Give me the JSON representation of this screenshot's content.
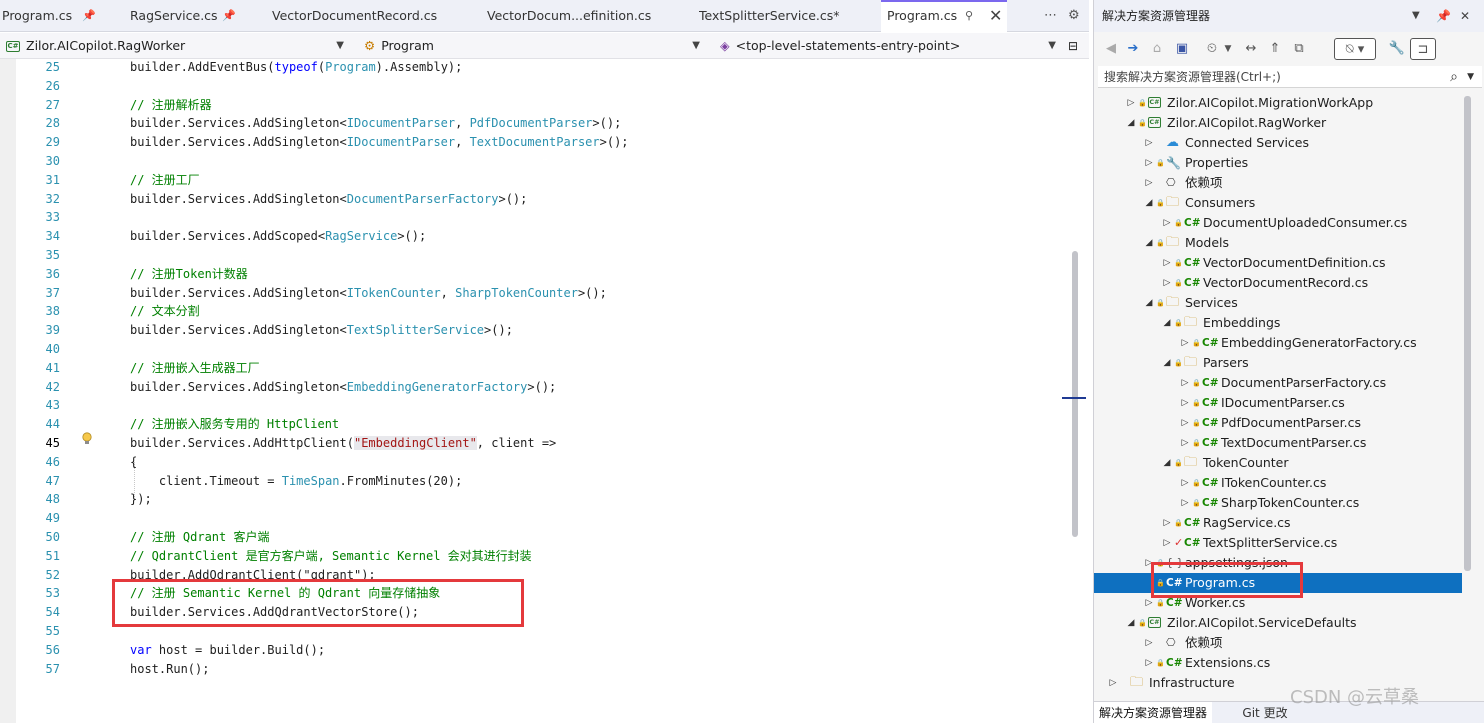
{
  "tabs": [
    {
      "label": "Program.cs",
      "pinned": true
    },
    {
      "label": "RagService.cs",
      "pinned": true
    },
    {
      "label": "VectorDocumentRecord.cs"
    },
    {
      "label": "VectorDocum...efinition.cs"
    },
    {
      "label": "TextSplitterService.cs*"
    },
    {
      "label": "Program.cs",
      "active": true
    }
  ],
  "navbar": {
    "project": "Zilor.AICopilot.RagWorker",
    "type": "Program",
    "member": "<top-level-statements-entry-point>"
  },
  "editor": {
    "current_line": "45",
    "lines": [
      {
        "n": "25",
        "segs": [
          {
            "t": "builder.AddEventBus("
          },
          {
            "t": "typeof",
            "c": "kw"
          },
          {
            "t": "("
          },
          {
            "t": "Program",
            "c": "ty"
          },
          {
            "t": ").Assembly);"
          }
        ]
      },
      {
        "n": "26",
        "segs": []
      },
      {
        "n": "27",
        "segs": [
          {
            "t": "// 注册解析器",
            "c": "cm"
          }
        ]
      },
      {
        "n": "28",
        "segs": [
          {
            "t": "builder.Services.AddSingleton<"
          },
          {
            "t": "IDocumentParser",
            "c": "ty"
          },
          {
            "t": ", "
          },
          {
            "t": "PdfDocumentParser",
            "c": "ty"
          },
          {
            "t": ">();"
          }
        ]
      },
      {
        "n": "29",
        "segs": [
          {
            "t": "builder.Services.AddSingleton<"
          },
          {
            "t": "IDocumentParser",
            "c": "ty"
          },
          {
            "t": ", "
          },
          {
            "t": "TextDocumentParser",
            "c": "ty"
          },
          {
            "t": ">();"
          }
        ]
      },
      {
        "n": "30",
        "segs": []
      },
      {
        "n": "31",
        "segs": [
          {
            "t": "// 注册工厂",
            "c": "cm"
          }
        ]
      },
      {
        "n": "32",
        "segs": [
          {
            "t": "builder.Services.AddSingleton<"
          },
          {
            "t": "DocumentParserFactory",
            "c": "ty"
          },
          {
            "t": ">();"
          }
        ]
      },
      {
        "n": "33",
        "segs": []
      },
      {
        "n": "34",
        "segs": [
          {
            "t": "builder.Services.AddScoped<"
          },
          {
            "t": "RagService",
            "c": "ty"
          },
          {
            "t": ">();"
          }
        ]
      },
      {
        "n": "35",
        "segs": []
      },
      {
        "n": "36",
        "segs": [
          {
            "t": "// 注册Token计数器",
            "c": "cm"
          }
        ]
      },
      {
        "n": "37",
        "segs": [
          {
            "t": "builder.Services.AddSingleton<"
          },
          {
            "t": "ITokenCounter",
            "c": "ty"
          },
          {
            "t": ", "
          },
          {
            "t": "SharpTokenCounter",
            "c": "ty"
          },
          {
            "t": ">();"
          }
        ]
      },
      {
        "n": "38",
        "segs": [
          {
            "t": "// 文本分割",
            "c": "cm"
          }
        ]
      },
      {
        "n": "39",
        "segs": [
          {
            "t": "builder.Services.AddSingleton<"
          },
          {
            "t": "TextSplitterService",
            "c": "ty"
          },
          {
            "t": ">();"
          }
        ]
      },
      {
        "n": "40",
        "segs": []
      },
      {
        "n": "41",
        "segs": [
          {
            "t": "// 注册嵌入生成器工厂",
            "c": "cm"
          }
        ]
      },
      {
        "n": "42",
        "segs": [
          {
            "t": "builder.Services.AddSingleton<"
          },
          {
            "t": "EmbeddingGeneratorFactory",
            "c": "ty"
          },
          {
            "t": ">();"
          }
        ]
      },
      {
        "n": "43",
        "segs": []
      },
      {
        "n": "44",
        "segs": [
          {
            "t": "// 注册嵌入服务专用的 HttpClient",
            "c": "cm"
          }
        ]
      },
      {
        "n": "45",
        "segs": [
          {
            "t": "builder.Services.AddHttpClient("
          },
          {
            "t": "\"EmbeddingClient\"",
            "c": "st hl"
          },
          {
            "t": ", client =>"
          }
        ]
      },
      {
        "n": "46",
        "segs": [
          {
            "t": "{"
          }
        ]
      },
      {
        "n": "47",
        "segs": [
          {
            "t": "    client.Timeout = "
          },
          {
            "t": "TimeSpan",
            "c": "ty"
          },
          {
            "t": ".FromMinutes(20);"
          }
        ]
      },
      {
        "n": "48",
        "segs": [
          {
            "t": "});"
          }
        ]
      },
      {
        "n": "49",
        "segs": []
      },
      {
        "n": "50",
        "segs": [
          {
            "t": "// 注册 Qdrant 客户端",
            "c": "cm"
          }
        ]
      },
      {
        "n": "51",
        "segs": [
          {
            "t": "// QdrantClient 是官方客户端, Semantic Kernel 会对其进行封装",
            "c": "cm"
          }
        ]
      },
      {
        "n": "52",
        "segs": [
          {
            "t": "builder.AddQdrantClient(\"qdrant\");"
          }
        ]
      },
      {
        "n": "53",
        "segs": [
          {
            "t": "// 注册 Semantic Kernel 的 Qdrant 向量存储抽象",
            "c": "cm"
          }
        ]
      },
      {
        "n": "54",
        "segs": [
          {
            "t": "builder.Services.AddQdrantVectorStore();"
          }
        ]
      },
      {
        "n": "55",
        "segs": []
      },
      {
        "n": "56",
        "segs": [
          {
            "t": "var",
            "c": "kw"
          },
          {
            "t": " host = builder.Build();"
          }
        ]
      },
      {
        "n": "57",
        "segs": [
          {
            "t": "host.Run();"
          }
        ]
      }
    ]
  },
  "solution_explorer": {
    "title": "解决方案资源管理器",
    "search_placeholder": "搜索解决方案资源管理器(Ctrl+;)",
    "items": [
      {
        "depth": 2,
        "exp": "collapsed",
        "lock": true,
        "icon": "proj",
        "label": "Zilor.AICopilot.MigrationWorkApp"
      },
      {
        "depth": 2,
        "exp": "expanded",
        "lock": true,
        "icon": "proj",
        "label": "Zilor.AICopilot.RagWorker"
      },
      {
        "depth": 3,
        "exp": "collapsed",
        "icon": "cloud",
        "label": "Connected Services"
      },
      {
        "depth": 3,
        "exp": "collapsed",
        "lock": true,
        "icon": "props",
        "label": "Properties"
      },
      {
        "depth": 3,
        "exp": "collapsed",
        "icon": "dep",
        "label": "依赖项"
      },
      {
        "depth": 3,
        "exp": "expanded",
        "lock": true,
        "icon": "folder",
        "label": "Consumers"
      },
      {
        "depth": 4,
        "exp": "collapsed",
        "lock": true,
        "icon": "cs",
        "label": "DocumentUploadedConsumer.cs"
      },
      {
        "depth": 3,
        "exp": "expanded",
        "lock": true,
        "icon": "folder",
        "label": "Models"
      },
      {
        "depth": 4,
        "exp": "collapsed",
        "lock": true,
        "icon": "cs",
        "label": "VectorDocumentDefinition.cs"
      },
      {
        "depth": 4,
        "exp": "collapsed",
        "lock": true,
        "icon": "cs",
        "label": "VectorDocumentRecord.cs"
      },
      {
        "depth": 3,
        "exp": "expanded",
        "lock": true,
        "icon": "folder",
        "label": "Services"
      },
      {
        "depth": 4,
        "exp": "expanded",
        "lock": true,
        "icon": "folder",
        "label": "Embeddings"
      },
      {
        "depth": 5,
        "exp": "collapsed",
        "lock": true,
        "icon": "cs",
        "label": "EmbeddingGeneratorFactory.cs"
      },
      {
        "depth": 4,
        "exp": "expanded",
        "lock": true,
        "icon": "folder",
        "label": "Parsers"
      },
      {
        "depth": 5,
        "exp": "collapsed",
        "lock": true,
        "icon": "cs",
        "label": "DocumentParserFactory.cs"
      },
      {
        "depth": 5,
        "exp": "collapsed",
        "lock": true,
        "icon": "cs",
        "label": "IDocumentParser.cs"
      },
      {
        "depth": 5,
        "exp": "collapsed",
        "lock": true,
        "icon": "cs",
        "label": "PdfDocumentParser.cs"
      },
      {
        "depth": 5,
        "exp": "collapsed",
        "lock": true,
        "icon": "cs",
        "label": "TextDocumentParser.cs"
      },
      {
        "depth": 4,
        "exp": "expanded",
        "lock": true,
        "icon": "folder",
        "label": "TokenCounter"
      },
      {
        "depth": 5,
        "exp": "collapsed",
        "lock": true,
        "icon": "cs",
        "label": "ITokenCounter.cs"
      },
      {
        "depth": 5,
        "exp": "collapsed",
        "lock": true,
        "icon": "cs",
        "label": "SharpTokenCounter.cs"
      },
      {
        "depth": 4,
        "exp": "collapsed",
        "lock": true,
        "icon": "cs",
        "label": "RagService.cs"
      },
      {
        "depth": 4,
        "exp": "collapsed",
        "check": true,
        "icon": "cs",
        "label": "TextSplitterService.cs"
      },
      {
        "depth": 3,
        "exp": "collapsed",
        "lock": true,
        "icon": "json",
        "label": "appsettings.json"
      },
      {
        "depth": 3,
        "exp": "none",
        "lock": true,
        "icon": "cs",
        "label": "Program.cs",
        "selected": true
      },
      {
        "depth": 3,
        "exp": "collapsed",
        "lock": true,
        "icon": "cs",
        "label": "Worker.cs"
      },
      {
        "depth": 2,
        "exp": "expanded",
        "lock": true,
        "icon": "proj",
        "label": "Zilor.AICopilot.ServiceDefaults"
      },
      {
        "depth": 3,
        "exp": "collapsed",
        "icon": "dep",
        "label": "依赖项"
      },
      {
        "depth": 3,
        "exp": "collapsed",
        "lock": true,
        "icon": "cs",
        "label": "Extensions.cs"
      },
      {
        "depth": 1,
        "exp": "collapsed",
        "icon": "folder",
        "label": "Infrastructure"
      }
    ],
    "bottom_tabs": [
      "解决方案资源管理器",
      "Git 更改"
    ]
  },
  "watermark": "CSDN @云草桑",
  "colors": {
    "accent": "#7b68ee",
    "selection": "#0e70c0",
    "highlight_box": "#e4393c",
    "comment": "#008000",
    "type": "#2b91af",
    "keyword": "#0000ff",
    "string": "#a31515"
  }
}
